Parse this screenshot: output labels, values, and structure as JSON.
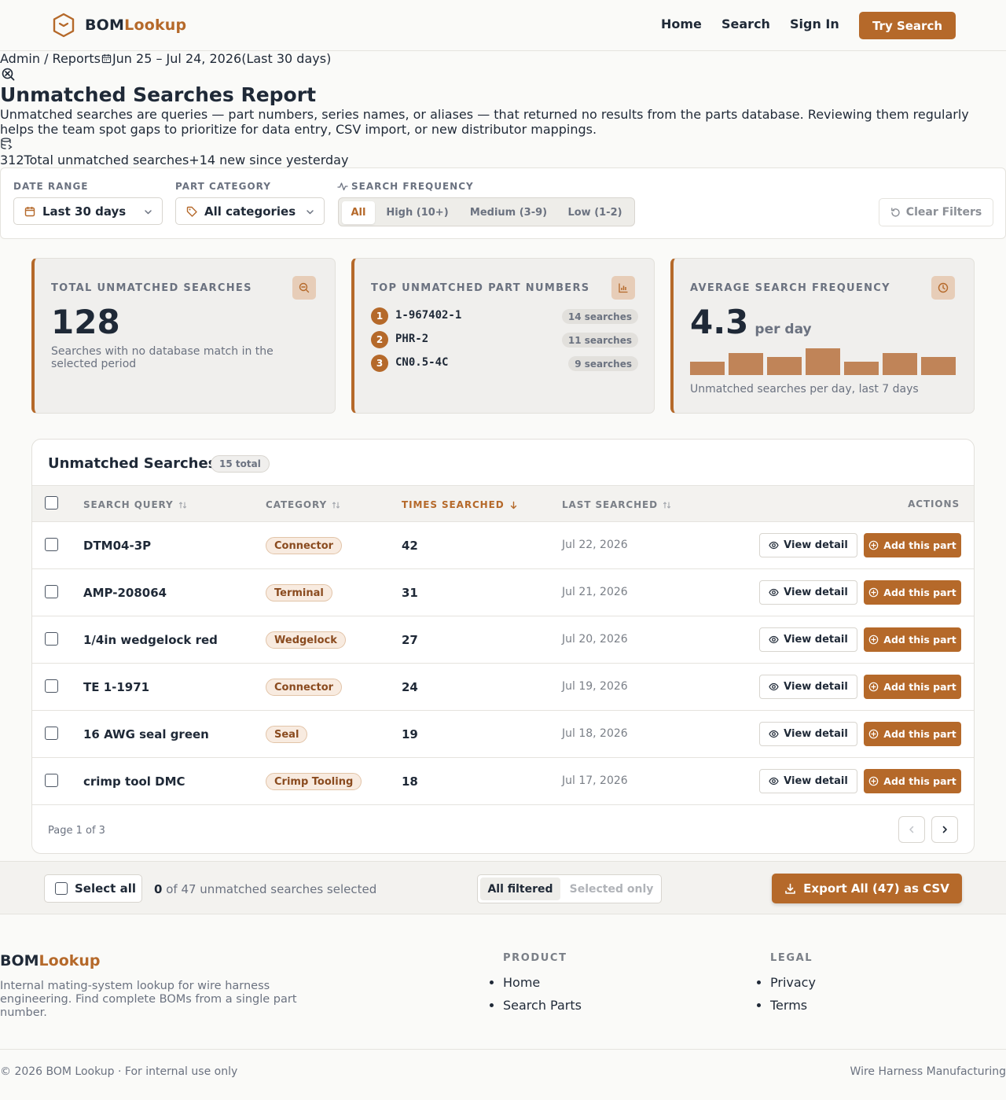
{
  "header": {
    "brand_a": "BOM",
    "brand_b": "Lookup",
    "nav": [
      "Home",
      "Search",
      "Sign In"
    ],
    "cta": "Try Search"
  },
  "breadcrumb": "Admin / Reports",
  "date_range_text": "Jun 25 – Jul 24, 2026",
  "date_range_note": "(Last 30 days)",
  "title": "Unmatched Searches Report",
  "description": "Unmatched searches are queries — part numbers, series names, or aliases — that returned no results from the parts database. Reviewing them regularly helps the team spot gaps to prioritize for data entry, CSV import, or new distributor mappings.",
  "summary": {
    "count": "312",
    "label": "Total unmatched searches",
    "delta": "+14 new since yesterday"
  },
  "filters": {
    "date_label": "DATE RANGE",
    "date_value": "Last 30 days",
    "category_label": "PART CATEGORY",
    "category_value": "All categories",
    "frequency_label": "SEARCH FREQUENCY",
    "frequency_options": [
      "All",
      "High (10+)",
      "Medium (3-9)",
      "Low (1-2)"
    ],
    "frequency_selected": "All",
    "clear": "Clear Filters"
  },
  "stats": {
    "total": {
      "label": "TOTAL UNMATCHED SEARCHES",
      "value": "128",
      "caption": "Searches with no database match in the selected period"
    },
    "top": {
      "label": "TOP UNMATCHED PART NUMBERS",
      "items": [
        {
          "rank": "1",
          "part": "1-967402-1",
          "count": "14 searches"
        },
        {
          "rank": "2",
          "part": "PHR-2",
          "count": "11 searches"
        },
        {
          "rank": "3",
          "part": "CN0.5-4C",
          "count": "9 searches"
        }
      ]
    },
    "average": {
      "label": "AVERAGE SEARCH FREQUENCY",
      "value": "4.3",
      "unit": "per day",
      "caption": "Unmatched searches per day, last 7 days",
      "daily": [
        3,
        5,
        4,
        6,
        3,
        5,
        4
      ],
      "bar_color": "#c08458"
    }
  },
  "table": {
    "title": "Unmatched Searches",
    "count_badge": "15 total",
    "columns": [
      "SEARCH QUERY",
      "CATEGORY",
      "TIMES SEARCHED",
      "LAST SEARCHED",
      "ACTIONS"
    ],
    "sorted_column": "TIMES SEARCHED",
    "view_label": "View detail",
    "add_label": "Add this part",
    "rows": [
      {
        "query": "DTM04-3P",
        "category": "Connector",
        "times": "42",
        "last": "Jul 22, 2026"
      },
      {
        "query": "AMP-208064",
        "category": "Terminal",
        "times": "31",
        "last": "Jul 21, 2026"
      },
      {
        "query": "1/4in wedgelock red",
        "category": "Wedgelock",
        "times": "27",
        "last": "Jul 20, 2026"
      },
      {
        "query": "TE 1-1971",
        "category": "Connector",
        "times": "24",
        "last": "Jul 19, 2026"
      },
      {
        "query": "16 AWG seal green",
        "category": "Seal",
        "times": "19",
        "last": "Jul 18, 2026"
      },
      {
        "query": "crimp tool DMC",
        "category": "Crimp Tooling",
        "times": "18",
        "last": "Jul 17, 2026"
      }
    ],
    "page_text": "Page 1 of 3"
  },
  "bulk": {
    "select_all": "Select all",
    "selected_count": "0",
    "selected_text": "of 47 unmatched searches selected",
    "scope_options": [
      "All filtered",
      "Selected only"
    ],
    "scope_selected": "All filtered",
    "export": "Export All (47) as CSV"
  },
  "footer": {
    "brand_a": "BOM",
    "brand_b": "Lookup",
    "description": "Internal mating-system lookup for wire harness engineering. Find complete BOMs from a single part number.",
    "product_heading": "PRODUCT",
    "product_links": [
      "Home",
      "Search Parts"
    ],
    "legal_heading": "LEGAL",
    "legal_links": [
      "Privacy",
      "Terms"
    ],
    "copyright": "© 2026 BOM Lookup · For internal use only",
    "tagline": "Wire Harness Manufacturing"
  },
  "colors": {
    "accent": "#b5692a",
    "accent_light": "#f8ebe0"
  },
  "icons": [
    "hexagon-logo-icon",
    "calendar-icon",
    "close-circle-icon",
    "database-icon",
    "tag-icon",
    "activity-icon",
    "chevron-down-icon",
    "refresh-icon",
    "search-minus-icon",
    "bar-chart-icon",
    "clock-icon",
    "sort-icon",
    "arrow-down-icon",
    "eye-icon",
    "plus-circle-icon",
    "chevron-left-icon",
    "chevron-right-icon",
    "download-icon"
  ]
}
